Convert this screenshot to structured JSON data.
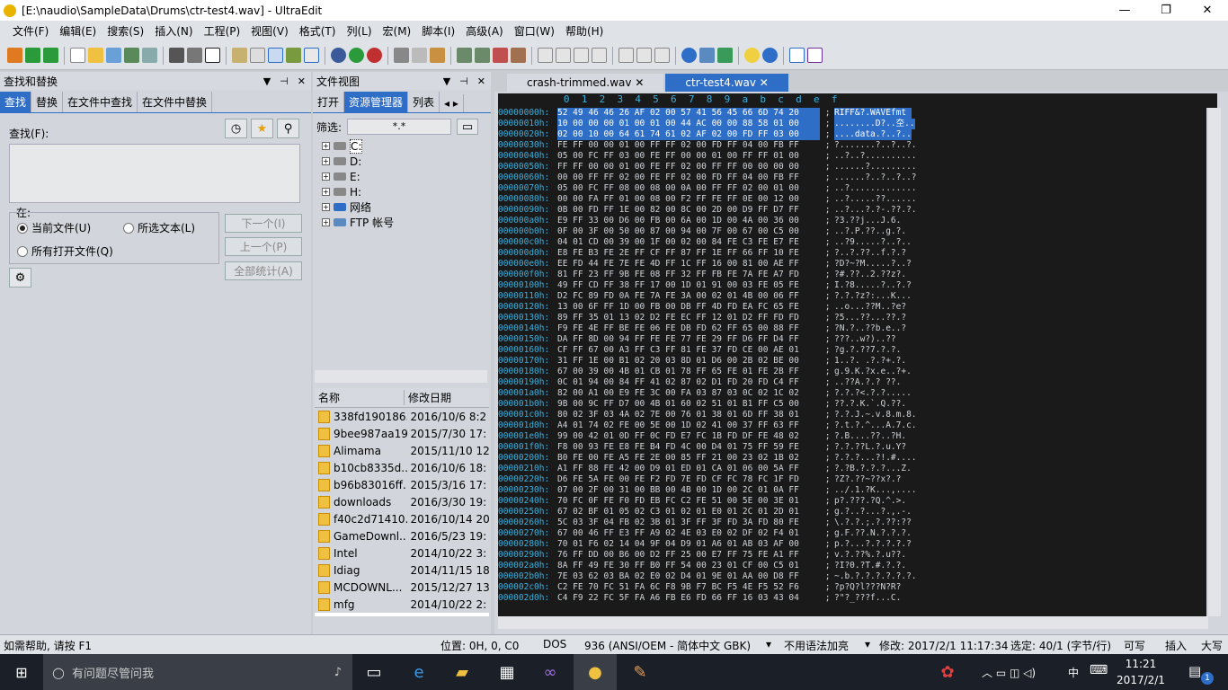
{
  "window": {
    "title": "[E:\\naudio\\SampleData\\Drums\\ctr-test4.wav] - UltraEdit",
    "minimize": "—",
    "maximize": "❐",
    "close": "✕"
  },
  "menu": [
    "文件(F)",
    "编辑(E)",
    "搜索(S)",
    "插入(N)",
    "工程(P)",
    "视图(V)",
    "格式(T)",
    "列(L)",
    "宏(M)",
    "脚本(I)",
    "高级(A)",
    "窗口(W)",
    "帮助(H)"
  ],
  "find_panel": {
    "title": "查找和替换",
    "tabs": [
      "查找",
      "替换",
      "在文件中查找",
      "在文件中替换"
    ],
    "find_label": "查找(F):",
    "in_label": "在:",
    "scope_current": "当前文件(U)",
    "scope_selection": "所选文本(L)",
    "scope_all": "所有打开文件(Q)",
    "btn_next": "下一个(I)",
    "btn_prev": "上一个(P)",
    "btn_count": "全部统计(A)"
  },
  "file_panel": {
    "title": "文件视图",
    "tabs": [
      "打开",
      "资源管理器",
      "列表"
    ],
    "filter_label": "筛选:",
    "filter_value": "*.*",
    "tree": [
      "C:",
      "D:",
      "E:",
      "H:",
      "网络",
      "FTP 帐号"
    ],
    "col_name": "名称",
    "col_date": "修改日期",
    "files": [
      {
        "name": "338fd190186...",
        "date": "2016/10/6 8:2"
      },
      {
        "name": "9bee987aa19...",
        "date": "2015/7/30 17:"
      },
      {
        "name": "Alimama",
        "date": "2015/11/10 12"
      },
      {
        "name": "b10cb8335d...",
        "date": "2016/10/6 18:"
      },
      {
        "name": "b96b83016ff...",
        "date": "2015/3/16 17:"
      },
      {
        "name": "downloads",
        "date": "2016/3/30 19:"
      },
      {
        "name": "f40c2d71410...",
        "date": "2016/10/14 20"
      },
      {
        "name": "GameDownl...",
        "date": "2016/5/23 19:"
      },
      {
        "name": "Intel",
        "date": "2014/10/22 3:"
      },
      {
        "name": "Idiag",
        "date": "2014/11/15 18"
      },
      {
        "name": "MCDOWNL...",
        "date": "2015/12/27 13"
      },
      {
        "name": "mfg",
        "date": "2014/10/22 2:"
      }
    ]
  },
  "editor": {
    "tabs": [
      "crash-trimmed.wav",
      "ctr-test4.wav"
    ],
    "ruler": "           0  1  2  3  4  5  6  7  8  9  a  b  c  d  e  f",
    "rows": [
      [
        "00000000h:",
        "52 49 46 46 26 AF 02 00 57 41 56 45 66 6D 74 20",
        "RIFF&?.WAVEfmt "
      ],
      [
        "00000010h:",
        "10 00 00 00 01 00 01 00 44 AC 00 00 88 58 01 00",
        "........D?..圶.."
      ],
      [
        "00000020h:",
        "02 00 10 00 64 61 74 61 02 AF 02 00 FD FF 03 00",
        "....data.?..?.."
      ],
      [
        "00000030h:",
        "FE FF 00 00 01 00 FF FF 02 00 FD FF 04 00 FB FF",
        "?.......?..?..?."
      ],
      [
        "00000040h:",
        "05 00 FC FF 03 00 FE FF 00 00 01 00 FF FF 01 00",
        "..?..?.........."
      ],
      [
        "00000050h:",
        "FF FF 00 00 01 00 FE FF 02 00 FF FF 00 00 00 00",
        "......?........."
      ],
      [
        "00000060h:",
        "00 00 FF FF 02 00 FE FF 02 00 FD FF 04 00 FB FF",
        "......?..?..?..?"
      ],
      [
        "00000070h:",
        "05 00 FC FF 08 00 08 00 0A 00 FF FF 02 00 01 00",
        "..?............."
      ],
      [
        "00000080h:",
        "00 00 FA FF 01 00 08 00 F2 FF FE FF 0E 00 12 00",
        "..?.....??......"
      ],
      [
        "00000090h:",
        "0B 00 FD FF 1E 00 82 00 8C 00 2D 00 D9 FF D7 FF",
        "..?...?.?-.??.?."
      ],
      [
        "000000a0h:",
        "E9 FF 33 00 D6 00 FB 00 6A 00 1D 00 4A 00 36 00",
        "?3.??j...J.6."
      ],
      [
        "000000b0h:",
        "0F 00 3F 00 50 00 87 00 94 00 7F 00 67 00 C5 00",
        "..?.P.??..g.?."
      ],
      [
        "000000c0h:",
        "04 01 CD 00 39 00 1F 00 02 00 84 FE C3 FE E7 FE",
        "..?9.....?..?.."
      ],
      [
        "000000d0h:",
        "E8 FE B3 FE 2E FF CF FF 87 FF 1E FF 66 FF 10 FE",
        "?..?.??..f.?.?"
      ],
      [
        "000000e0h:",
        "EE FD 44 FE 7E FE 4D FF 1C FF 16 00 81 00 AE FF",
        "?D?~?M.....?..?"
      ],
      [
        "000000f0h:",
        "81 FF 23 FF 9B FE 08 FF 32 FF FB FE 7A FE A7 FD",
        "?#.??..2.??z?."
      ],
      [
        "00000100h:",
        "49 FF CD FF 38 FF 17 00 1D 01 91 00 03 FE 05 FE",
        "I.?8.....?..?.?"
      ],
      [
        "00000110h:",
        "D2 FC 89 FD 0A FE 7A FE 3A 00 02 01 4B 00 06 FF",
        "?.?.?z?:...K..."
      ],
      [
        "00000120h:",
        "13 00 6F FF 1D 00 FB 00 DB FF 4D FD EA FC 65 FE",
        "..o...??M..?e?"
      ],
      [
        "00000130h:",
        "89 FF 35 01 13 02 D2 FE EC FF 12 01 D2 FF FD FD",
        "?5...??...??.?"
      ],
      [
        "00000140h:",
        "F9 FE 4E FF BE FE 06 FE DB FD 62 FF 65 00 88 FF",
        "?N.?..??b.e..?"
      ],
      [
        "00000150h:",
        "DA FF 8D 00 94 FF FE FE 77 FE 29 FF D6 FF D4 FF",
        "???..w?)..??"
      ],
      [
        "00000160h:",
        "CF FF 67 00 A3 FF C3 FF 81 FE 37 FD CE 00 AE 01",
        "?g.?.??7.?.?."
      ],
      [
        "00000170h:",
        "31 FF 1E 00 B1 02 20 03 8D 01 D6 00 2B 02 BE 00",
        "1..?. .?.?+.?."
      ],
      [
        "00000180h:",
        "67 00 39 00 4B 01 CB 01 78 FF 65 FE 01 FE 2B FF",
        "g.9.K.?x.e..?+."
      ],
      [
        "00000190h:",
        "0C 01 94 00 84 FF 41 02 87 02 D1 FD 20 FD C4 FF",
        "..??A.?.? ??."
      ],
      [
        "000001a0h:",
        "82 00 A1 00 E9 FE 3C 00 FA 03 87 03 0C 02 1C 02",
        "?.?.?<.?.?....."
      ],
      [
        "000001b0h:",
        "9B 00 9C FF D7 00 4B 01 60 02 51 01 B1 FF C5 00",
        "??.?.K.`.Q.??."
      ],
      [
        "000001c0h:",
        "80 02 3F 03 4A 02 7E 00 76 01 38 01 6D FF 38 01",
        "?.?.J.~.v.8.m.8."
      ],
      [
        "000001d0h:",
        "A4 01 74 02 FE 00 5E 00 1D 02 41 00 37 FF 63 FF",
        "?.t.?.^...A.7.c."
      ],
      [
        "000001e0h:",
        "99 00 42 01 0D FF 0C FD E7 FC 1B FD DF FE 48 02",
        "?.B....??..?H."
      ],
      [
        "000001f0h:",
        "F8 00 93 FE E8 FE B4 FD 4C 00 D4 01 75 FF 59 FE",
        "?.?.??L.?.u.Y?"
      ],
      [
        "00000200h:",
        "B0 FE 00 FE A5 FE 2E 00 85 FF 21 00 23 02 1B 02",
        "?.?.?...?!.#...."
      ],
      [
        "00000210h:",
        "A1 FF 88 FE 42 00 D9 01 ED 01 CA 01 06 00 5A FF",
        "?.?B.?.?.?...Z."
      ],
      [
        "00000220h:",
        "D6 FE 5A FE 00 FE F2 FD 7E FD CF FC 78 FC 1F FD",
        "?Z?.??~??x?.?"
      ],
      [
        "00000230h:",
        "07 00 2F 00 31 00 BB 00 4B 00 1D 00 2C 01 0A FF",
        "../.1.?K...,...."
      ],
      [
        "00000240h:",
        "70 FC 0F FE F0 FD EB FC C2 FE 51 00 5E 00 3E 01",
        "p?.???.?Q.^.>."
      ],
      [
        "00000250h:",
        "67 02 BF 01 05 02 C3 01 02 01 E0 01 2C 01 2D 01",
        "g.?..?...?.,.-."
      ],
      [
        "00000260h:",
        "5C 03 3F 04 FB 02 3B 01 3F FF 3F FD 3A FD 80 FE",
        "\\.?.?.;.?.??:??"
      ],
      [
        "00000270h:",
        "67 00 46 FF E3 FF A9 02 4E 03 E0 02 DF 02 F4 01",
        "g.F.??.N.?.?.?."
      ],
      [
        "00000280h:",
        "70 01 F6 02 14 04 9F 04 D9 01 A6 01 AB 03 AF 00",
        "p.?...?.?.?.?.?"
      ],
      [
        "00000290h:",
        "76 FF DD 00 B6 00 D2 FF 25 00 E7 FF 75 FE A1 FF",
        "v.?.??%.?.u??."
      ],
      [
        "000002a0h:",
        "8A FF 49 FE 30 FF B0 FF 54 00 23 01 CF 00 C5 01",
        "?I?0.?T.#.?.?."
      ],
      [
        "000002b0h:",
        "7E 03 62 03 BA 02 E0 02 D4 01 9E 01 AA 00 D8 FF",
        "~.b.?.?.?.?.?.?."
      ],
      [
        "000002c0h:",
        "C2 FE 70 FC 51 FA 6C F8 9B F7 BC F5 4E F5 52 F6",
        "?p?Q?l???N?R?"
      ],
      [
        "000002d0h:",
        "C4 F9 22 FC 5F FA A6 FB E6 FD 66 FF 16 03 43 04",
        "?\"?_???f...C."
      ]
    ]
  },
  "status": {
    "help": "如需帮助, 请按 F1",
    "position": "位置: 0H, 0, C0",
    "line_ending": "DOS",
    "codepage": "936  (ANSI/OEM - 简体中文 GBK)",
    "highlight": "不用语法加亮",
    "modified": "修改: 2017/2/1 11:17:34",
    "selection": "选定: 40/1 (字节/行)",
    "writable": "可写",
    "insert": "插入",
    "caps": "大写"
  },
  "taskbar": {
    "search_placeholder": "有问题尽管问我",
    "time": "11:21",
    "date": "2017/2/1",
    "ime": "中",
    "notif_count": "1"
  },
  "colors": {
    "accent": "#2f6ec7",
    "hex_bg": "#1a1a1a",
    "offset": "#3cb0e0"
  }
}
